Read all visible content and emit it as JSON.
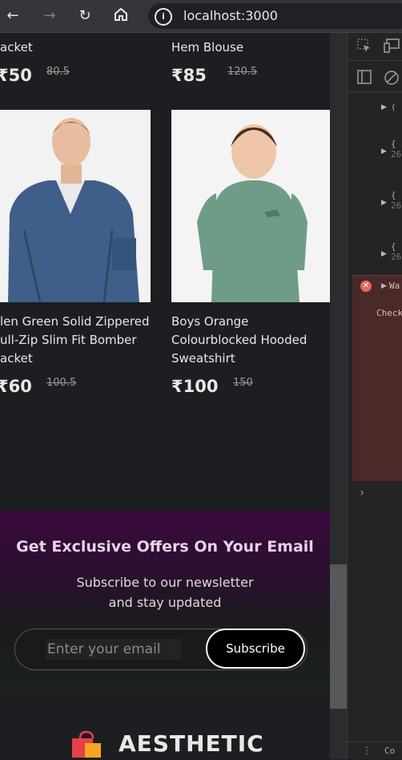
{
  "browser": {
    "url": "localhost:3000",
    "back_icon": "arrow-left-icon",
    "forward_icon": "arrow-right-icon",
    "reload_icon": "reload-icon",
    "home_icon": "home-icon"
  },
  "products": [
    {
      "name": "acket",
      "price": "₹50",
      "old_price": "80.5"
    },
    {
      "name": "Hem Blouse",
      "price": "₹85",
      "old_price": "120.5"
    },
    {
      "name": "len Green Solid Zippered ull-Zip Slim Fit Bomber acket",
      "price": "₹60",
      "old_price": "100.5"
    },
    {
      "name": "Boys Orange Colourblocked Hooded Sweatshirt",
      "price": "₹100",
      "old_price": "150"
    }
  ],
  "newsletter": {
    "title": "Get Exclusive Offers On Your Email",
    "line1": "Subscribe to our newsletter",
    "line2": "and stay updated",
    "placeholder": "Enter your email",
    "button": "Subscribe"
  },
  "brand": {
    "name": "AESTHETIC"
  },
  "devtools": {
    "entry1": "(",
    "entry2": "{",
    "entry2_sub": "26",
    "warn_label": "Wa",
    "warn_text": "Check",
    "bottom": "Co"
  }
}
